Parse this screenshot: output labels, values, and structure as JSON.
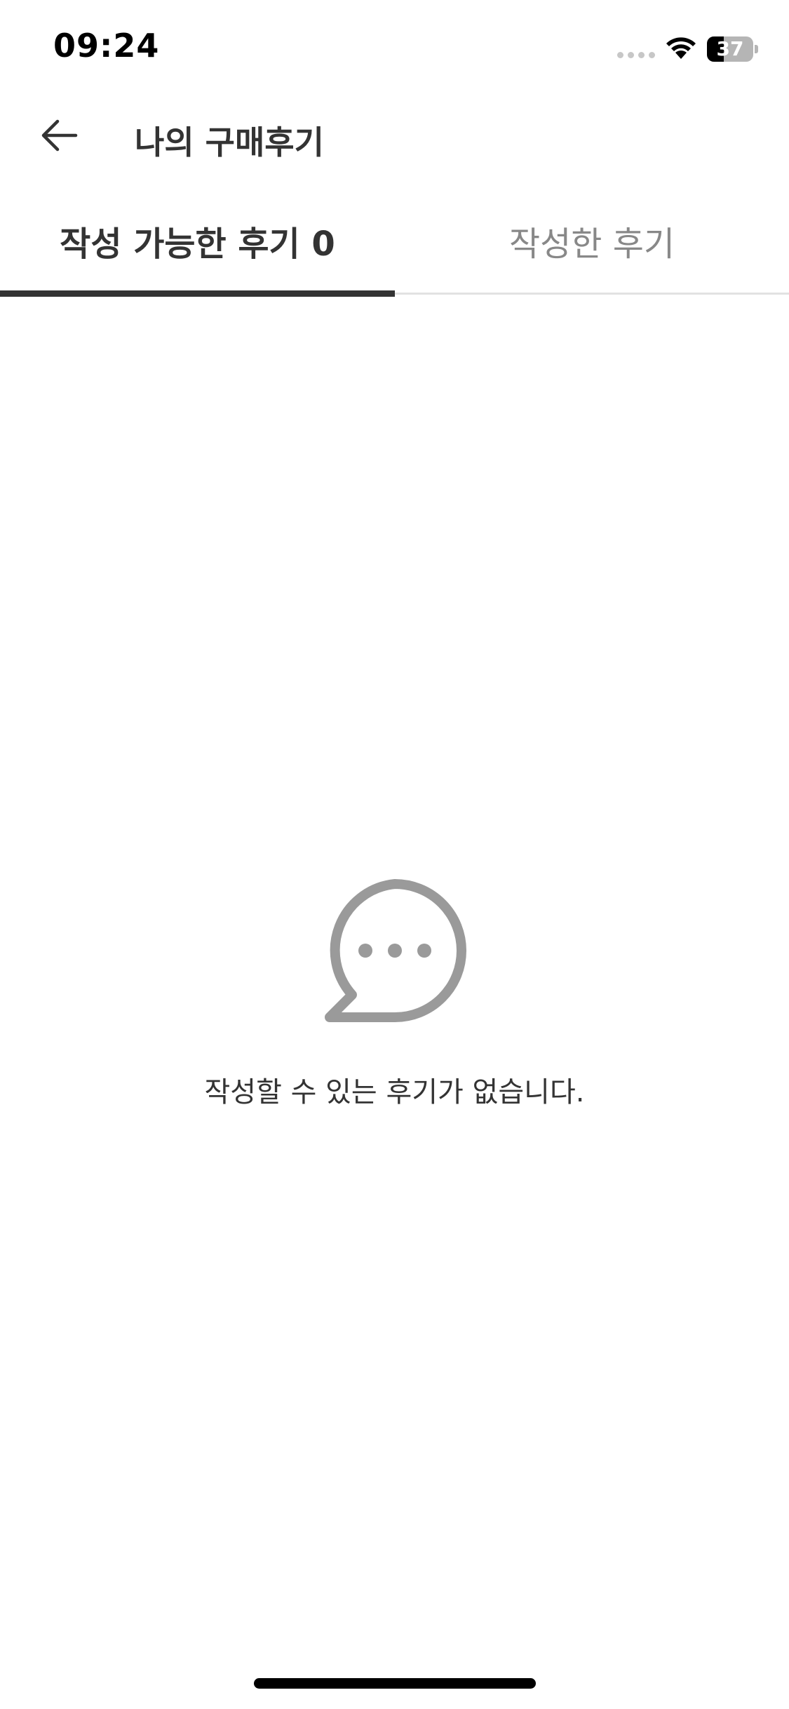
{
  "status_bar": {
    "time": "09:24",
    "battery_level": "37",
    "battery_fraction": 0.37,
    "icons": [
      "signal-dots-icon",
      "wifi-icon",
      "battery-icon"
    ]
  },
  "header": {
    "title": "나의 구매후기",
    "back_icon": "arrow-left-icon"
  },
  "tabs": [
    {
      "label": "작성 가능한 후기 0",
      "active": true
    },
    {
      "label": "작성한 후기",
      "active": false
    }
  ],
  "empty_state": {
    "icon": "chat-bubble-icon",
    "message": "작성할 수 있는 후기가 없습니다."
  },
  "colors": {
    "text_primary": "#333333",
    "text_inactive": "#888888",
    "icon_gray": "#9a9a9a",
    "tab_divider": "#e2e2e2"
  }
}
